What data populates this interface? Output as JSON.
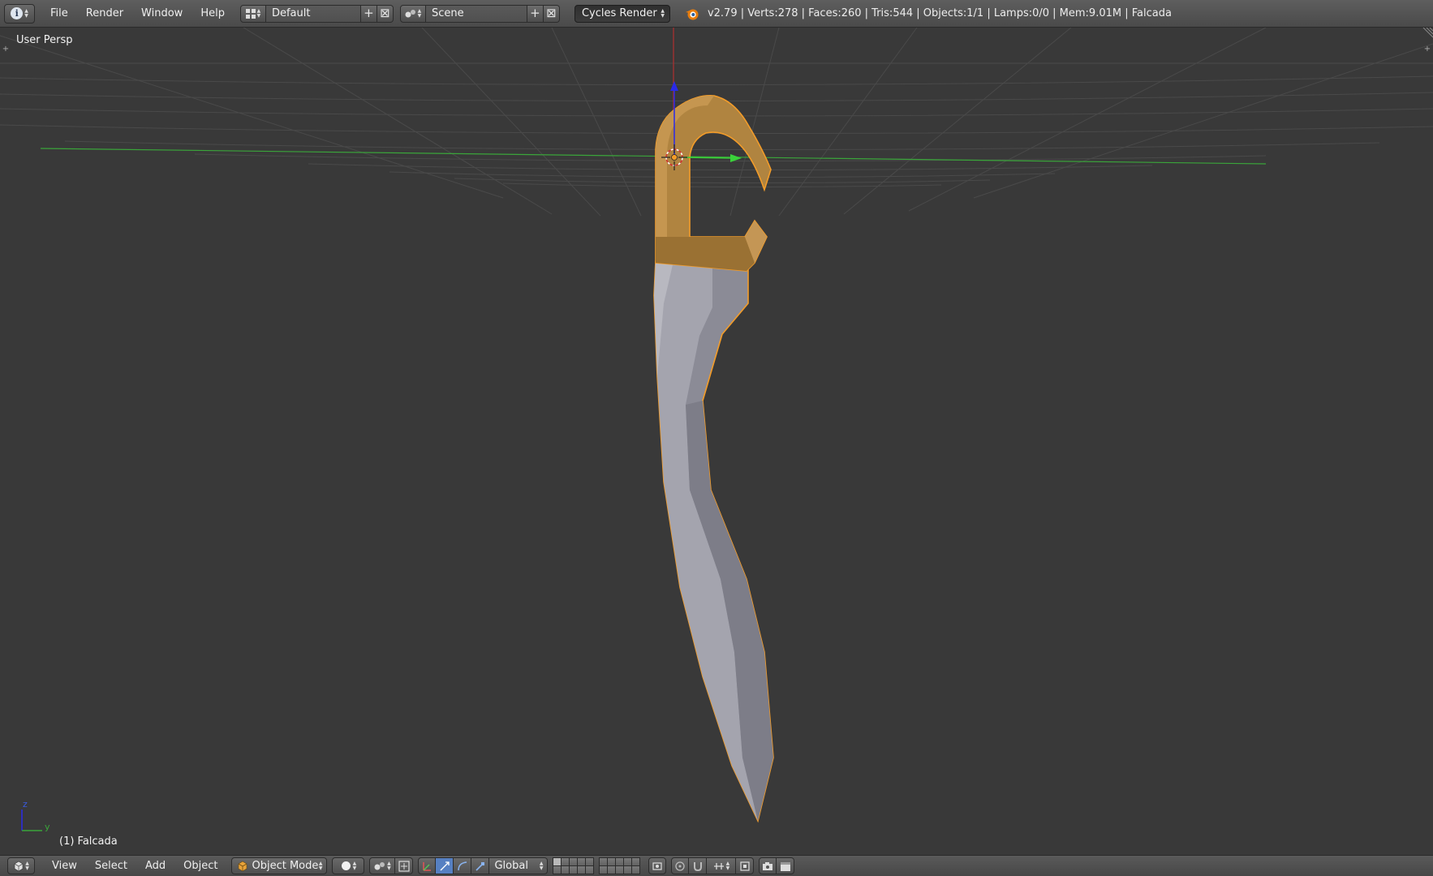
{
  "top_header": {
    "menus": [
      "File",
      "Render",
      "Window",
      "Help"
    ],
    "screen_layout": "Default",
    "scene": "Scene",
    "render_engine": "Cycles Render",
    "stats": "v2.79 | Verts:278 | Faces:260 | Tris:544 | Objects:1/1 | Lamps:0/0 | Mem:9.01M | Falcada"
  },
  "viewport": {
    "view_label": "User Persp",
    "object_label": "(1) Falcada",
    "axis_labels": {
      "z": "z",
      "y": "y"
    },
    "colors": {
      "background": "#393939",
      "grid": "#4a4a4a",
      "x_axis": "#b03030",
      "y_axis": "#3aa53a",
      "z_axis": "#2a2ae8",
      "selection_outline": "#f39c29",
      "handle": "#b28642",
      "blade": "#8d8d99"
    }
  },
  "bottom_header": {
    "menus": [
      "View",
      "Select",
      "Add",
      "Object"
    ],
    "mode": "Object Mode",
    "transform_orientation": "Global"
  }
}
